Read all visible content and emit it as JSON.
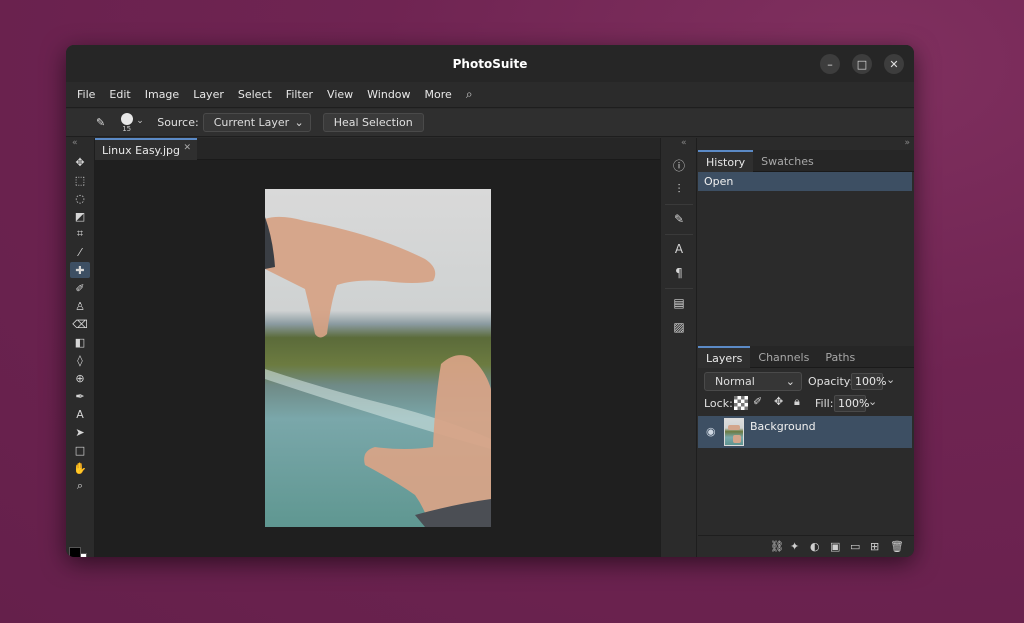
{
  "window": {
    "title": "PhotoSuite"
  },
  "window_controls": {
    "minimize": "–",
    "maximize": "□",
    "close": "✕"
  },
  "menu": {
    "items": [
      "File",
      "Edit",
      "Image",
      "Layer",
      "Select",
      "Filter",
      "View",
      "Window",
      "More"
    ]
  },
  "tool_options": {
    "brush_size": "15",
    "source_label": "Source:",
    "source_value": "Current Layer",
    "heal_button": "Heal Selection"
  },
  "document": {
    "tab_name": "Linux Easy.jpg"
  },
  "history_panel": {
    "tabs": [
      "History",
      "Swatches"
    ],
    "items": [
      "Open"
    ]
  },
  "layers_panel": {
    "tabs": [
      "Layers",
      "Channels",
      "Paths"
    ],
    "blend_mode": "Normal",
    "opacity_label": "Opacity:",
    "opacity_value": "100%",
    "lock_label": "Lock:",
    "fill_label": "Fill:",
    "fill_value": "100%",
    "layers": [
      {
        "name": "Background"
      }
    ]
  },
  "colors": {
    "foreground": "#000000",
    "background": "#ffffff",
    "accent": "#5b8ac6",
    "selection": "#3d4f63"
  }
}
